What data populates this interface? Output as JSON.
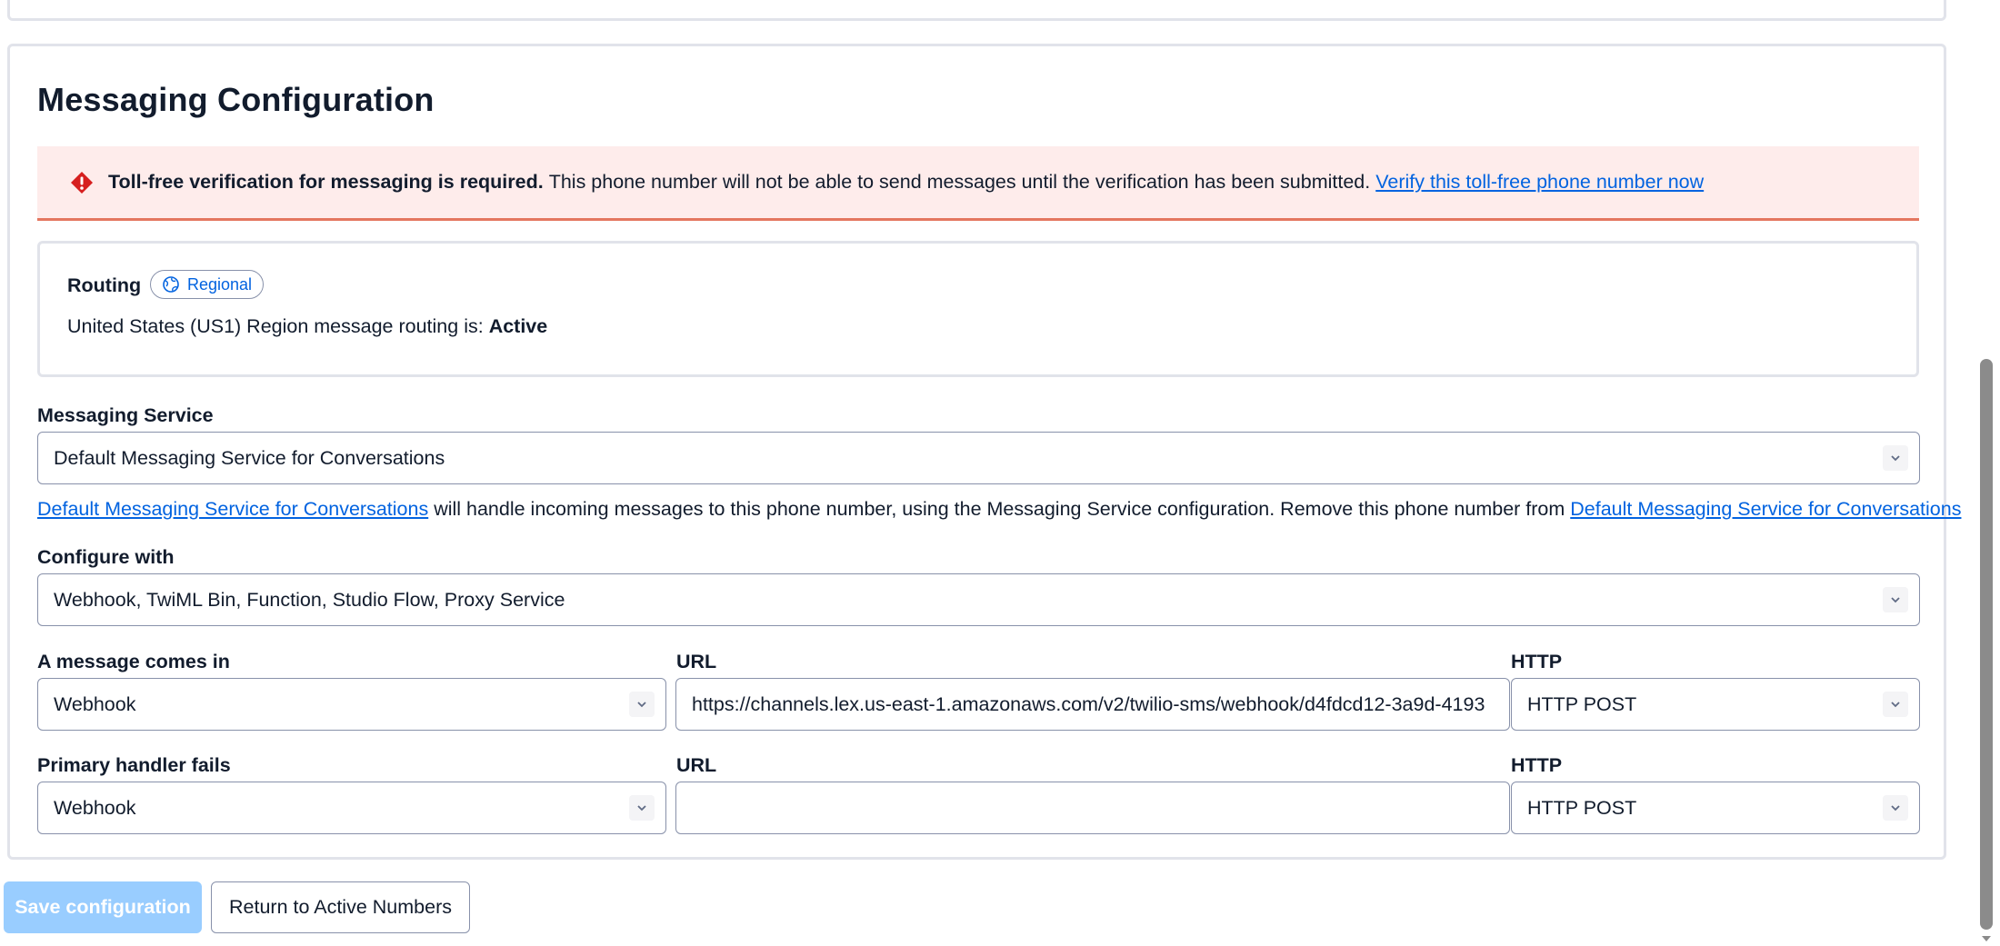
{
  "section": {
    "title": "Messaging Configuration"
  },
  "alert": {
    "bold": "Toll-free verification for messaging is required.",
    "text": "This phone number will not be able to send messages until the verification has been submitted.",
    "link": "Verify this toll-free phone number now",
    "icon": "error-diamond-icon",
    "color": "#d61f1f"
  },
  "routing": {
    "label": "Routing",
    "badge": "Regional",
    "badge_icon": "globe-icon",
    "status_prefix": "United States (US1) Region message routing is:",
    "status": "Active"
  },
  "messaging_service": {
    "label": "Messaging Service",
    "selected": "Default Messaging Service for Conversations",
    "help_link_1": "Default Messaging Service for Conversations",
    "help_text": "will handle incoming messages to this phone number, using the Messaging Service configuration. Remove this phone number from",
    "help_link_2": "Default Messaging Service for Conversations"
  },
  "configure_with": {
    "label": "Configure with",
    "selected": "Webhook, TwiML Bin, Function, Studio Flow, Proxy Service"
  },
  "message_comes_in": {
    "label": "A message comes in",
    "handler": "Webhook",
    "url_label": "URL",
    "url_value": "https://channels.lex.us-east-1.amazonaws.com/v2/twilio-sms/webhook/d4fdcd12-3a9d-4193",
    "http_label": "HTTP",
    "http_method": "HTTP POST"
  },
  "primary_handler_fails": {
    "label": "Primary handler fails",
    "handler": "Webhook",
    "url_label": "URL",
    "url_value": "",
    "http_label": "HTTP",
    "http_method": "HTTP POST"
  },
  "buttons": {
    "save": "Save configuration",
    "return": "Return to Active Numbers"
  },
  "colors": {
    "accent": "#0263e0",
    "alert_bg": "#feeceb",
    "alert_border": "#e4765f",
    "primary_disabled": "#99cdff"
  }
}
